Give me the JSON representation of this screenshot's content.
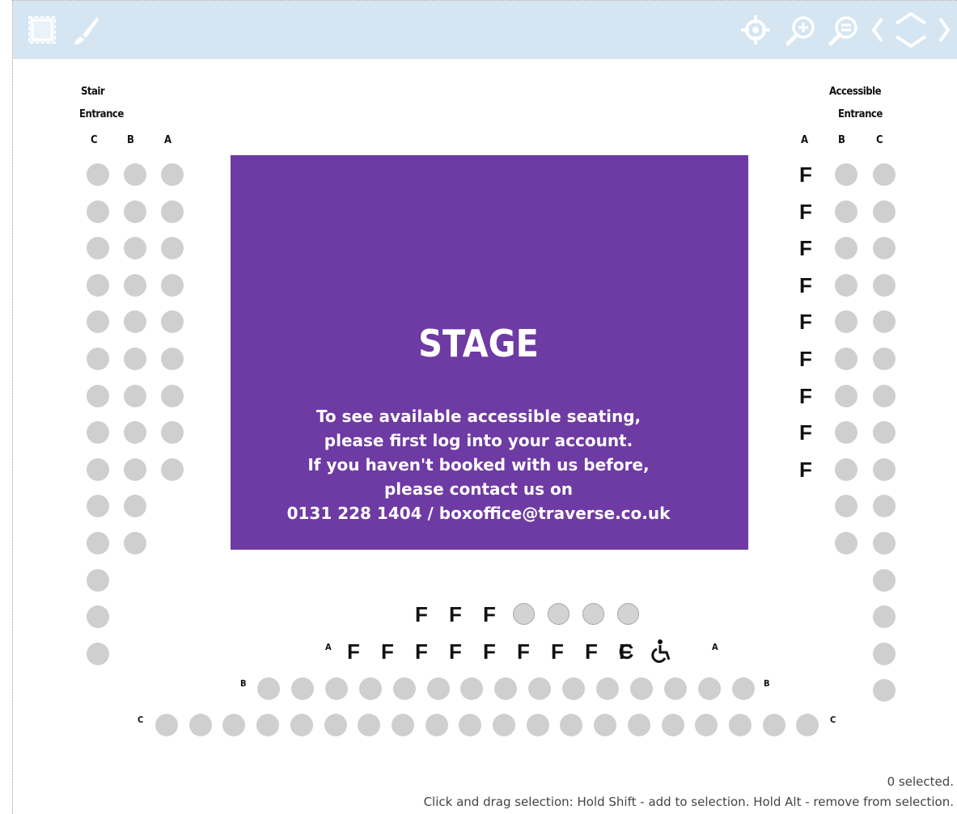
{
  "toolbar": {
    "left_tools": [
      "selection-tool-icon",
      "brush-icon"
    ],
    "right_tools": [
      "recenter-icon",
      "zoom-in-icon",
      "zoom-out-icon",
      "pan-arrows-icon"
    ]
  },
  "labels": {
    "stair_entrance_line1": "Stair",
    "stair_entrance_line2": "Entrance",
    "accessible_entrance_line1": "Accessible",
    "accessible_entrance_line2": "Entrance",
    "row_a": "A",
    "row_b": "B",
    "row_c": "C"
  },
  "stage": {
    "title": "STAGE",
    "lines": [
      "To see available accessible seating,",
      "please first log into your account.",
      "If you haven't booked with us before,",
      "please contact us on",
      "0131 228 1404 / boxoffice@traverse.co.uk"
    ]
  },
  "seat_marks": {
    "f": "F",
    "c": "C",
    "wheelchair_icon": "wheelchair-icon"
  },
  "seating": {
    "left_rows": 14,
    "right_rows": 15,
    "front_row_f_marks": 3,
    "front_row_outline_seats": 4,
    "row_a_f_marks": 9,
    "row_b_seats": 15,
    "row_c_seats": 20
  },
  "status": {
    "count": "0 selected.",
    "help": "Click and drag selection: Hold Shift - add to selection. Hold Alt - remove from selection."
  },
  "colors": {
    "stage": "#6e3aa3",
    "toolbar": "#d5e5f2",
    "seat": "#cfcfcf"
  }
}
